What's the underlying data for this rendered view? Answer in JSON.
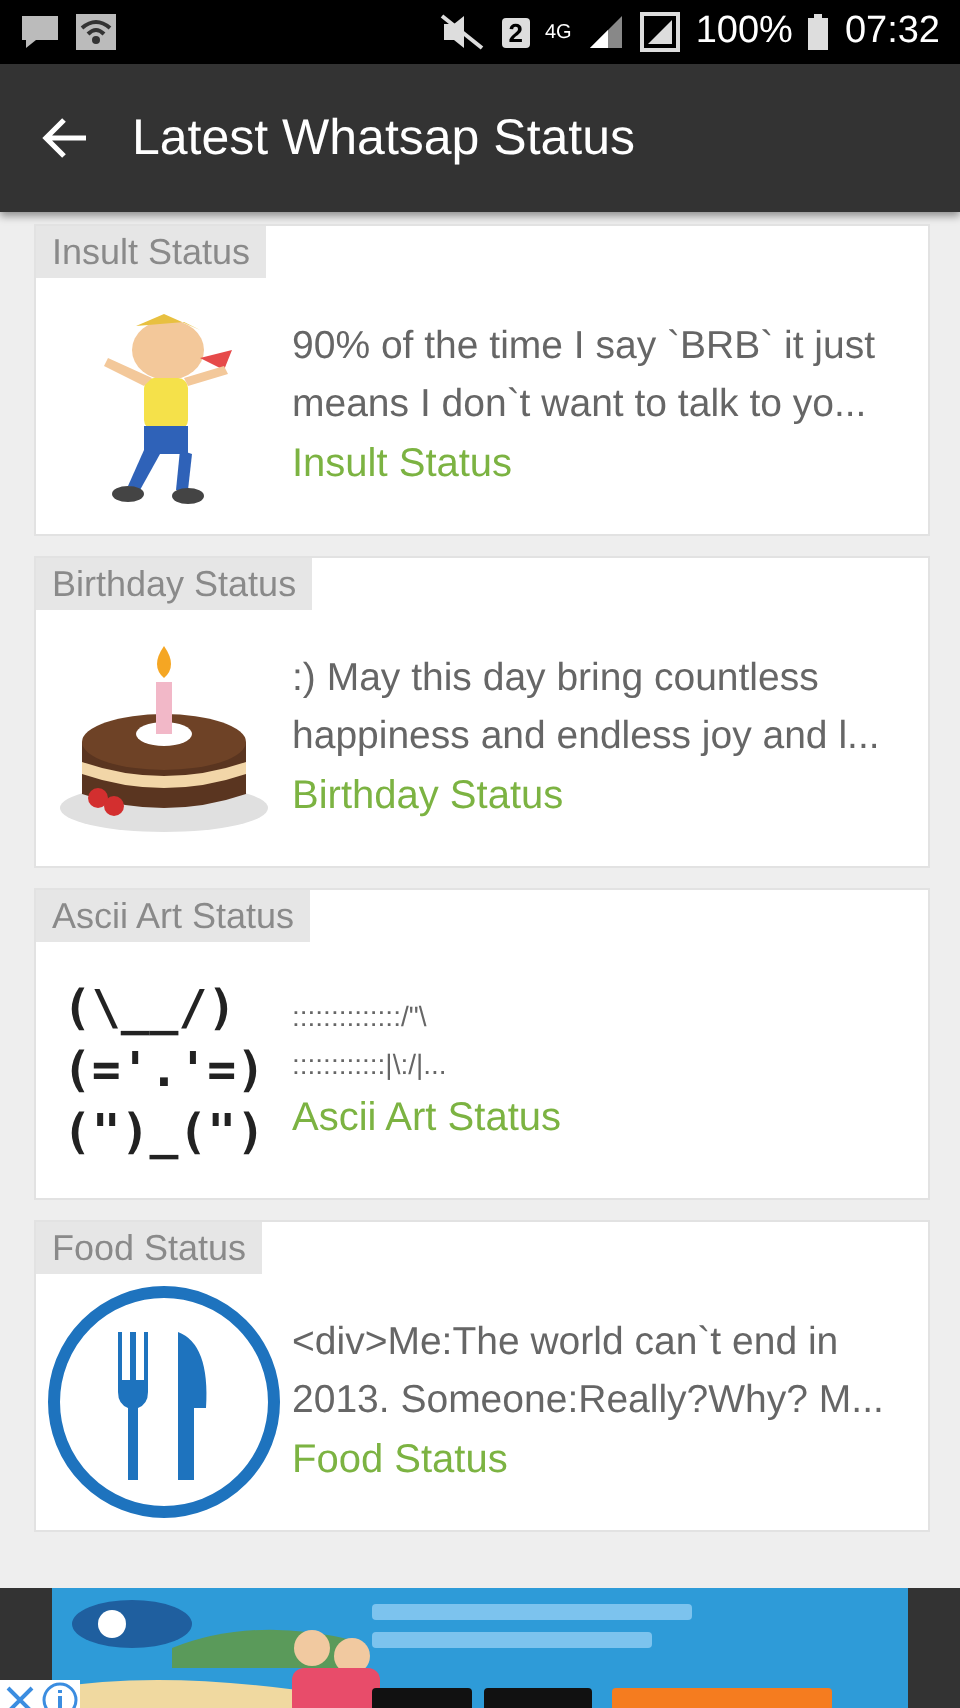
{
  "status_bar": {
    "sim": "2",
    "network": "4G",
    "battery": "100%",
    "time": "07:32"
  },
  "app_bar": {
    "title": "Latest Whatsap Status"
  },
  "items": [
    {
      "tag": "Insult Status",
      "thumb": {
        "kind": "cartoon"
      },
      "lines": [
        "90% of the time I say `BRB` it just",
        "means I don`t want to talk to yo..."
      ],
      "category": "Insult Status"
    },
    {
      "tag": "Birthday Status",
      "thumb": {
        "kind": "cake"
      },
      "lines": [
        ":) May this day bring countless",
        "happiness and endless joy and l..."
      ],
      "category": "Birthday Status"
    },
    {
      "tag": "Ascii Art Status",
      "thumb": {
        "kind": "ascii",
        "art": [
          "(\\__/)",
          "(='.'=)",
          "(\")_(\")"
        ]
      },
      "lines": [
        "::::::::::::::/\"\\",
        "::::::::::::|\\:/|..."
      ],
      "category": "Ascii Art Status"
    },
    {
      "tag": "Food Status",
      "thumb": {
        "kind": "cutlery"
      },
      "lines": [
        "<div>Me:The world can`t end in",
        "2013. Someone:Really?Why? M..."
      ],
      "category": "Food Status"
    }
  ]
}
